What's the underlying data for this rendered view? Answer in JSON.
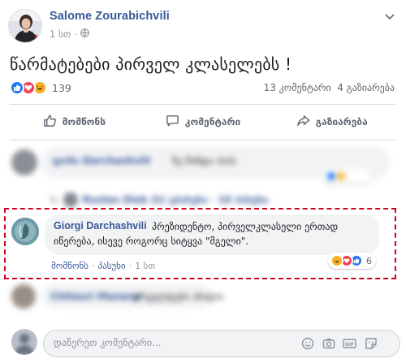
{
  "post": {
    "author": "Salome Zourabichvili",
    "time": "1 სთ",
    "audience_icon": "globe-icon",
    "text": "წარმატებები პირველ კლასელებს !"
  },
  "stats": {
    "reaction_count": "139",
    "comments": "13 კომენტარი",
    "shares": "4 გაზიარება"
  },
  "actions": {
    "like": "მომწონს",
    "comment": "კომენტარი",
    "share": "გაზიარება"
  },
  "highlighted_comment": {
    "author": "Giorgi Darchashvili",
    "text_line1": "პრეზიდენტო, პირველკლასელი ერთად",
    "text_line2": "იწერება, ისევე როგორც სიტყვა \"მგელი\".",
    "like_label": "მომწონს",
    "reply_label": "პასუხი",
    "time": "1 სთ",
    "reaction_count": "6"
  },
  "blurred": {
    "c1_name": "ფონი Darchashvili",
    "c1_text": "ნუ მინდა ჰაჰა",
    "reply_row": "Ruslan Diak (ს) უპასუხა · 10 პასუხი",
    "c3_name": "Chitauri Manana",
    "c3_text": "ვრცელდება ახალი"
  },
  "composer": {
    "placeholder": "დაწერეთ კომენტარი..."
  },
  "colors": {
    "link": "#385898",
    "like": "#2078f4",
    "love": "#f33e58",
    "haha": "#f7b125",
    "highlight_border": "#d0021b"
  }
}
